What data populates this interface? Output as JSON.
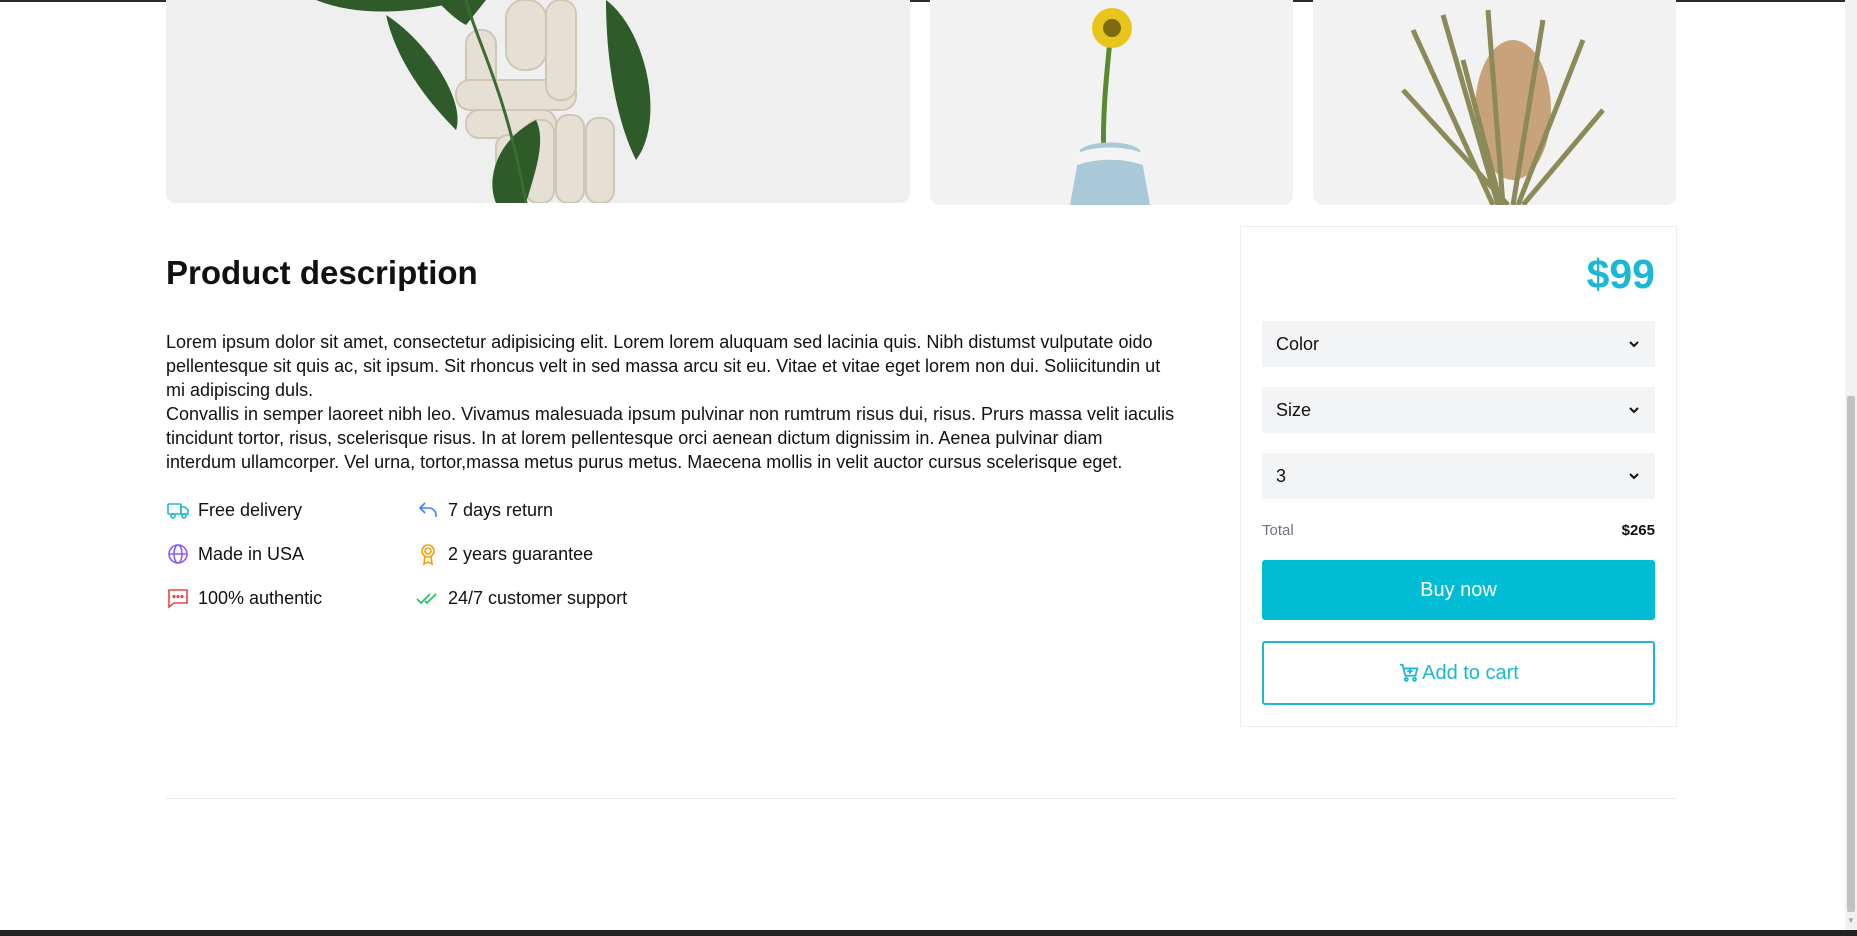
{
  "gallery": {
    "images": [
      {
        "name": "ceramic-sculpture-with-leaves"
      },
      {
        "name": "yellow-flower-in-blue-vase"
      },
      {
        "name": "dried-banksia-flower"
      }
    ]
  },
  "description": {
    "title": "Product description",
    "paragraph_1": "Lorem ipsum dolor sit amet, consectetur adipisicing elit. Lorem lorem aluquam sed lacinia quis. Nibh distumst vulputate oido pellentesque sit quis ac, sit ipsum. Sit rhoncus velt in sed massa arcu sit eu. Vitae et vitae eget lorem non dui. Soliicitundin ut mi adipiscing duls.",
    "paragraph_2": "Convallis in semper laoreet nibh leo. Vivamus malesuada ipsum pulvinar non rumtrum risus dui, risus. Prurs massa velit iaculis tincidunt tortor, risus, scelerisque risus. In at lorem pellentesque orci aenean dictum dignissim in. Aenea pulvinar diam interdum ullamcorper. Vel urna, tortor,massa metus purus metus. Maecena mollis in velit auctor cursus scelerisque eget."
  },
  "features": [
    {
      "label": "Free delivery",
      "icon": "truck-icon",
      "color": "#1ab8d4"
    },
    {
      "label": "7 days return",
      "icon": "return-arrow-icon",
      "color": "#3b82f6"
    },
    {
      "label": "Made in USA",
      "icon": "globe-icon",
      "color": "#8b5cf6"
    },
    {
      "label": "2 years guarantee",
      "icon": "award-icon",
      "color": "#f59e0b"
    },
    {
      "label": "100% authentic",
      "icon": "chat-icon",
      "color": "#ef4444"
    },
    {
      "label": "24/7 customer support",
      "icon": "double-check-icon",
      "color": "#22c55e"
    }
  ],
  "purchase": {
    "price": "$99",
    "color_select": "Color",
    "size_select": "Size",
    "quantity_select": "3",
    "total_label": "Total",
    "total_value": "$265",
    "buy_label": "Buy now",
    "cart_label": "Add to cart",
    "accent_color": "#00bcd4"
  }
}
